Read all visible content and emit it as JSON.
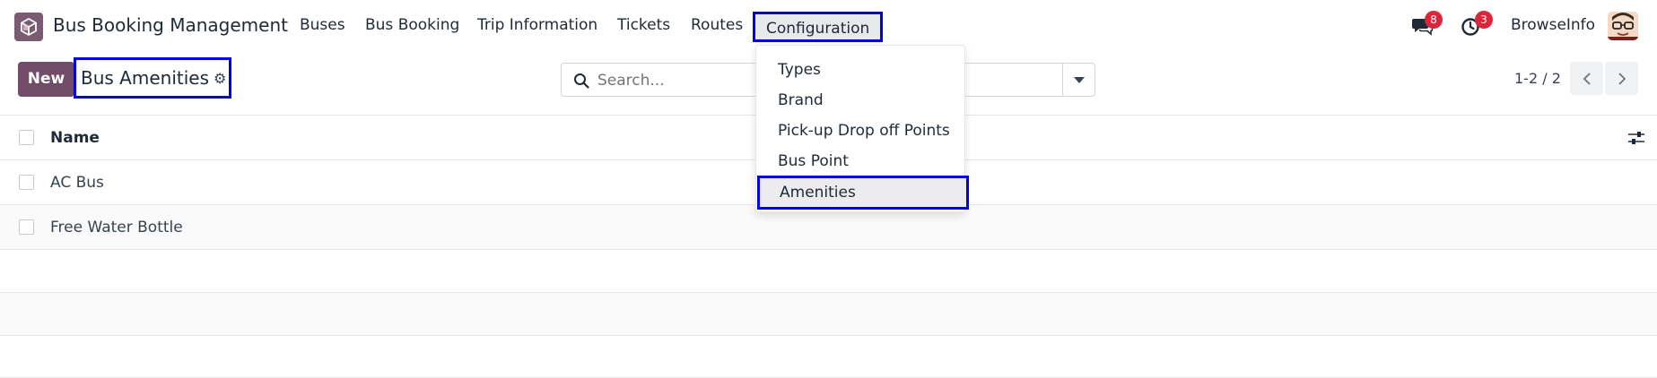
{
  "app": {
    "name": "Bus Booking Management"
  },
  "menu": [
    {
      "label": "Buses"
    },
    {
      "label": "Bus Booking"
    },
    {
      "label": "Trip Information"
    },
    {
      "label": "Tickets"
    },
    {
      "label": "Routes"
    },
    {
      "label": "Configuration",
      "active": true
    }
  ],
  "systray": {
    "messages_badge": "8",
    "activities_badge": "3",
    "company": "BrowseInfo"
  },
  "control_panel": {
    "new_label": "New",
    "title": "Bus Amenities",
    "search_placeholder": "Search...",
    "pager": "1-2 / 2"
  },
  "table": {
    "columns": [
      "Name"
    ],
    "rows": [
      {
        "name": "AC Bus"
      },
      {
        "name": "Free Water Bottle"
      }
    ]
  },
  "dropdown": {
    "items": [
      {
        "label": "Types"
      },
      {
        "label": "Brand"
      },
      {
        "label": "Pick-up Drop off Points"
      },
      {
        "label": "Bus Point"
      },
      {
        "label": "Amenities",
        "active": true
      }
    ]
  },
  "colors": {
    "brand": "#714b67",
    "highlight_border": "#0000e0",
    "badge": "#d9263a"
  }
}
